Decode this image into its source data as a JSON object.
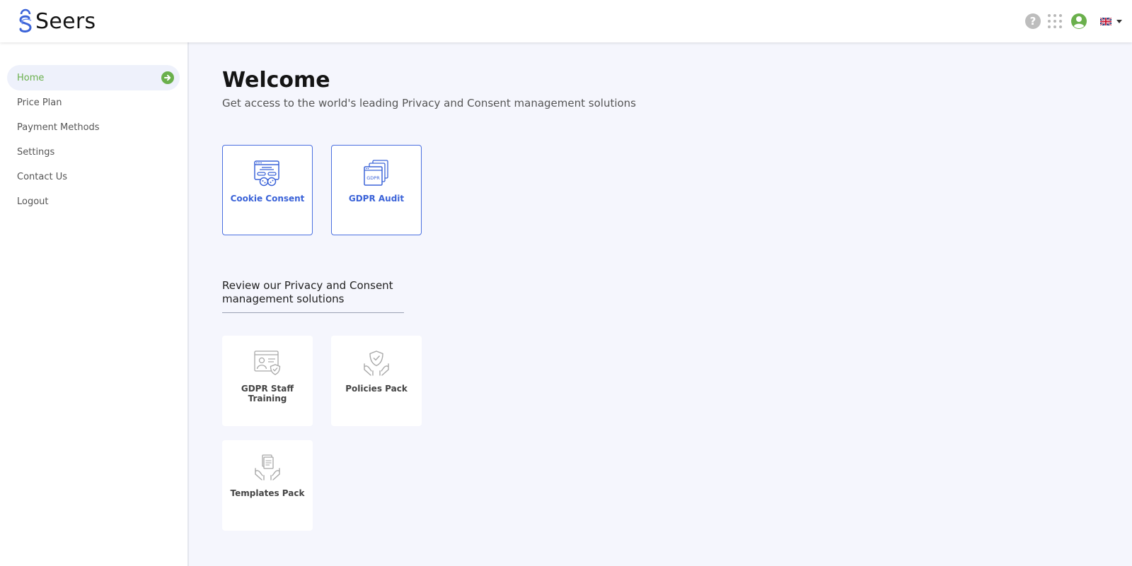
{
  "header": {
    "brand": "Seers",
    "icons": [
      "help-icon",
      "apps-grid-icon",
      "user-account-icon",
      "uk-flag-icon",
      "caret-down-icon"
    ],
    "help_glyph": "?"
  },
  "sidebar": {
    "items": [
      {
        "label": "Home",
        "active": true
      },
      {
        "label": "Price Plan"
      },
      {
        "label": "Payment Methods"
      },
      {
        "label": "Settings"
      },
      {
        "label": "Contact Us"
      },
      {
        "label": "Logout"
      }
    ]
  },
  "main": {
    "title": "Welcome",
    "subtitle": "Get access to the world's leading Privacy and Consent management solutions",
    "products": [
      {
        "label": "Cookie Consent",
        "icon": "cookie-consent-icon"
      },
      {
        "label": "GDPR Audit",
        "icon": "gdpr-audit-icon",
        "icon_text": "GDPR"
      }
    ],
    "review_title": "Review our Privacy and Consent management solutions",
    "solutions": [
      {
        "label": "GDPR Staff Training",
        "icon": "staff-training-icon"
      },
      {
        "label": "Policies Pack",
        "icon": "policies-pack-icon"
      },
      {
        "label": "Templates Pack",
        "icon": "templates-pack-icon"
      }
    ]
  },
  "colors": {
    "accent_green": "#6ab04c",
    "accent_blue": "#3b63d8",
    "main_bg": "#f5f6fd"
  }
}
